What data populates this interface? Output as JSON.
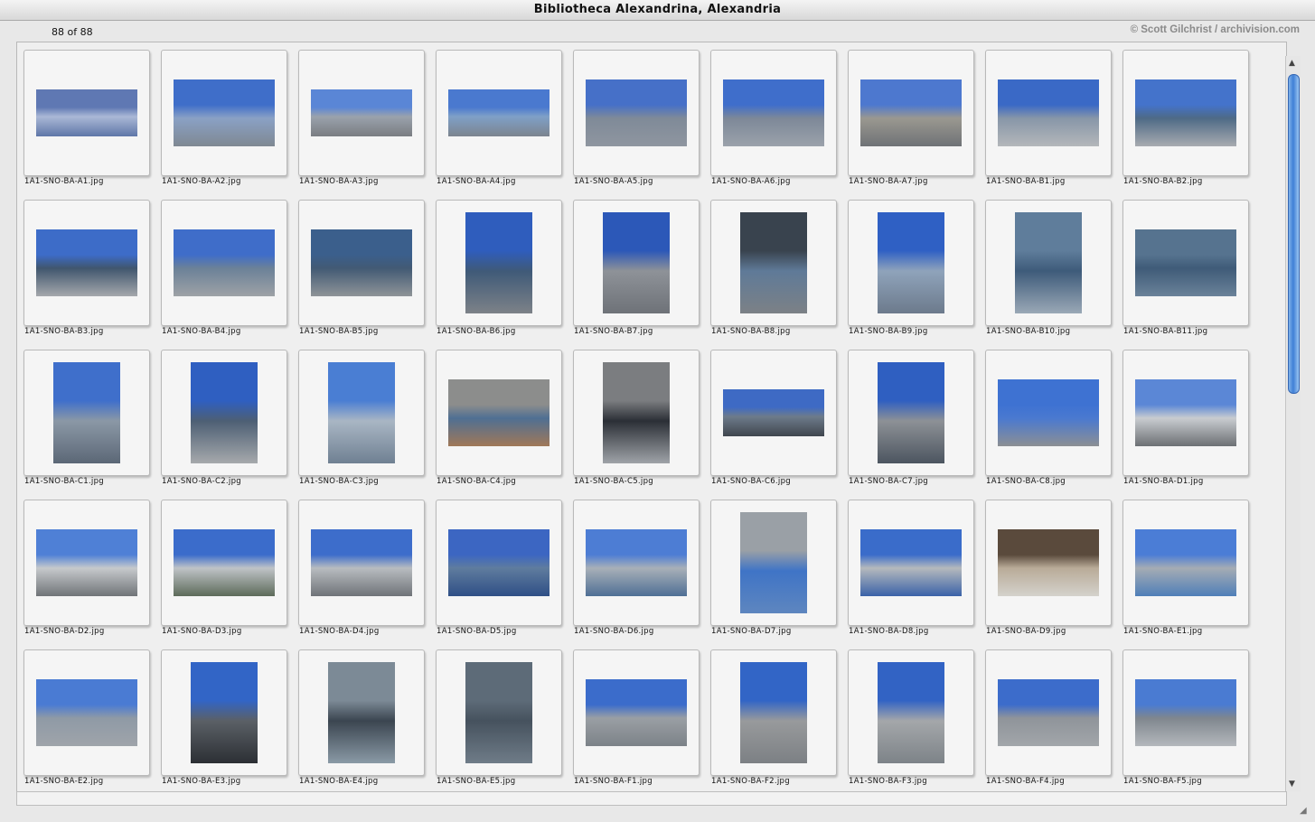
{
  "window": {
    "title": "Bibliotheca Alexandrina, Alexandria"
  },
  "info": {
    "count": "88 of 88",
    "credit": "© Scott Gilchrist / archivision.com"
  },
  "thumbnails": [
    {
      "name": "1A1-SNO-BA-A1.jpg",
      "shape": "wide",
      "colors": [
        "#5f78b3",
        "#aab8d6",
        "#5f76a8"
      ]
    },
    {
      "name": "1A1-SNO-BA-A2.jpg",
      "shape": "land",
      "colors": [
        "#3f6ec9",
        "#8aa1c5",
        "#7f8892"
      ]
    },
    {
      "name": "1A1-SNO-BA-A3.jpg",
      "shape": "wide",
      "colors": [
        "#5a86d6",
        "#9aa2ac",
        "#7a7d82"
      ]
    },
    {
      "name": "1A1-SNO-BA-A4.jpg",
      "shape": "wide",
      "colors": [
        "#4a79cf",
        "#7fa0c7",
        "#7c848e"
      ]
    },
    {
      "name": "1A1-SNO-BA-A5.jpg",
      "shape": "land",
      "colors": [
        "#4670c8",
        "#7f8a98",
        "#8f96a0"
      ]
    },
    {
      "name": "1A1-SNO-BA-A6.jpg",
      "shape": "land",
      "colors": [
        "#3f6ecb",
        "#7d8898",
        "#9ba2ab"
      ]
    },
    {
      "name": "1A1-SNO-BA-A7.jpg",
      "shape": "land",
      "colors": [
        "#4d78cf",
        "#9a9890",
        "#6f7276"
      ]
    },
    {
      "name": "1A1-SNO-BA-B1.jpg",
      "shape": "land",
      "colors": [
        "#3a69c6",
        "#8796a8",
        "#b4b7ba"
      ]
    },
    {
      "name": "1A1-SNO-BA-B2.jpg",
      "shape": "land",
      "colors": [
        "#4473cb",
        "#4e6a86",
        "#a8abb0"
      ]
    },
    {
      "name": "1A1-SNO-BA-B3.jpg",
      "shape": "land",
      "colors": [
        "#3d6cc8",
        "#40566e",
        "#a5a8ac"
      ]
    },
    {
      "name": "1A1-SNO-BA-B4.jpg",
      "shape": "land",
      "colors": [
        "#3f6dc9",
        "#6b8198",
        "#9ea2a6"
      ]
    },
    {
      "name": "1A1-SNO-BA-B5.jpg",
      "shape": "land",
      "colors": [
        "#3b5f8c",
        "#425a74",
        "#8f9498"
      ]
    },
    {
      "name": "1A1-SNO-BA-B6.jpg",
      "shape": "port",
      "colors": [
        "#2f5dbd",
        "#3f5a78",
        "#7d8288"
      ]
    },
    {
      "name": "1A1-SNO-BA-B7.jpg",
      "shape": "port",
      "colors": [
        "#2c58b8",
        "#8e9298",
        "#6e7278"
      ]
    },
    {
      "name": "1A1-SNO-BA-B8.jpg",
      "shape": "port",
      "colors": [
        "#39434e",
        "#5f7a98",
        "#7c8186"
      ]
    },
    {
      "name": "1A1-SNO-BA-B9.jpg",
      "shape": "port",
      "colors": [
        "#2f60c4",
        "#8fa3bb",
        "#6c7a8c"
      ]
    },
    {
      "name": "1A1-SNO-BA-B10.jpg",
      "shape": "port",
      "colors": [
        "#5f7d9b",
        "#3e5b7a",
        "#9aa8b6"
      ]
    },
    {
      "name": "1A1-SNO-BA-B11.jpg",
      "shape": "land",
      "colors": [
        "#56738f",
        "#3f5b78",
        "#6a8299"
      ]
    },
    {
      "name": "1A1-SNO-BA-C1.jpg",
      "shape": "port",
      "colors": [
        "#3f6fcb",
        "#8b98a6",
        "#5b6776"
      ]
    },
    {
      "name": "1A1-SNO-BA-C2.jpg",
      "shape": "port",
      "colors": [
        "#2f5fc1",
        "#4d5f74",
        "#a6a9ac"
      ]
    },
    {
      "name": "1A1-SNO-BA-C3.jpg",
      "shape": "port",
      "colors": [
        "#4a7ed3",
        "#a9b6c4",
        "#6f8092"
      ]
    },
    {
      "name": "1A1-SNO-BA-C4.jpg",
      "shape": "land",
      "colors": [
        "#8c8d8c",
        "#4f6f93",
        "#a07858"
      ]
    },
    {
      "name": "1A1-SNO-BA-C5.jpg",
      "shape": "port",
      "colors": [
        "#7b7d80",
        "#2b2f36",
        "#9fa3a8"
      ]
    },
    {
      "name": "1A1-SNO-BA-C6.jpg",
      "shape": "wide",
      "colors": [
        "#3e6ac4",
        "#6d7b8b",
        "#40464e"
      ]
    },
    {
      "name": "1A1-SNO-BA-C7.jpg",
      "shape": "port",
      "colors": [
        "#2f5fc1",
        "#8d9196",
        "#4c5560"
      ]
    },
    {
      "name": "1A1-SNO-BA-C8.jpg",
      "shape": "land",
      "colors": [
        "#3e72d2",
        "#4a79d0",
        "#8c8f93"
      ]
    },
    {
      "name": "1A1-SNO-BA-D1.jpg",
      "shape": "land",
      "colors": [
        "#5b87d6",
        "#c9ccd0",
        "#6c7074"
      ]
    },
    {
      "name": "1A1-SNO-BA-D2.jpg",
      "shape": "land",
      "colors": [
        "#4f80d6",
        "#c6c9cc",
        "#707478"
      ]
    },
    {
      "name": "1A1-SNO-BA-D3.jpg",
      "shape": "land",
      "colors": [
        "#3b6ccb",
        "#bfc3c7",
        "#5d6b5a"
      ]
    },
    {
      "name": "1A1-SNO-BA-D4.jpg",
      "shape": "land",
      "colors": [
        "#3d6dcb",
        "#b8bcc0",
        "#6f7378"
      ]
    },
    {
      "name": "1A1-SNO-BA-D5.jpg",
      "shape": "land",
      "colors": [
        "#3c66c2",
        "#5f7c9e",
        "#2f4f86"
      ]
    },
    {
      "name": "1A1-SNO-BA-D6.jpg",
      "shape": "land",
      "colors": [
        "#4d7dd4",
        "#a8b0b8",
        "#4f6f95"
      ]
    },
    {
      "name": "1A1-SNO-BA-D7.jpg",
      "shape": "port",
      "colors": [
        "#9aa0a6",
        "#3f74c6",
        "#5e86bf"
      ]
    },
    {
      "name": "1A1-SNO-BA-D8.jpg",
      "shape": "land",
      "colors": [
        "#3a6cca",
        "#b5b9bd",
        "#3a62a8"
      ]
    },
    {
      "name": "1A1-SNO-BA-D9.jpg",
      "shape": "land",
      "colors": [
        "#5a4a3c",
        "#b9ab98",
        "#d4d2cc"
      ]
    },
    {
      "name": "1A1-SNO-BA-E1.jpg",
      "shape": "land",
      "colors": [
        "#4b7dd6",
        "#a5acb4",
        "#4f7fb8"
      ]
    },
    {
      "name": "1A1-SNO-BA-E2.jpg",
      "shape": "land",
      "colors": [
        "#4a7bd3",
        "#8f9aa6",
        "#9fa4aa"
      ]
    },
    {
      "name": "1A1-SNO-BA-E3.jpg",
      "shape": "port",
      "colors": [
        "#3265c6",
        "#5b6066",
        "#2c2f34"
      ]
    },
    {
      "name": "1A1-SNO-BA-E4.jpg",
      "shape": "port",
      "colors": [
        "#7c8a96",
        "#3b4550",
        "#8a9aa6"
      ]
    },
    {
      "name": "1A1-SNO-BA-E5.jpg",
      "shape": "port",
      "colors": [
        "#5d6b78",
        "#46525e",
        "#6f7c88"
      ]
    },
    {
      "name": "1A1-SNO-BA-F1.jpg",
      "shape": "land",
      "colors": [
        "#3b6ccb",
        "#9a9fa4",
        "#7c8288"
      ]
    },
    {
      "name": "1A1-SNO-BA-F2.jpg",
      "shape": "port",
      "colors": [
        "#3265c6",
        "#989a9c",
        "#7c8084"
      ]
    },
    {
      "name": "1A1-SNO-BA-F3.jpg",
      "shape": "port",
      "colors": [
        "#3263c4",
        "#a4a7aa",
        "#7d8388"
      ]
    },
    {
      "name": "1A1-SNO-BA-F4.jpg",
      "shape": "land",
      "colors": [
        "#3c6ccb",
        "#8f949a",
        "#a2a6aa"
      ]
    },
    {
      "name": "1A1-SNO-BA-F5.jpg",
      "shape": "land",
      "colors": [
        "#4a7bd2",
        "#7f868e",
        "#b4b8bc"
      ]
    }
  ]
}
